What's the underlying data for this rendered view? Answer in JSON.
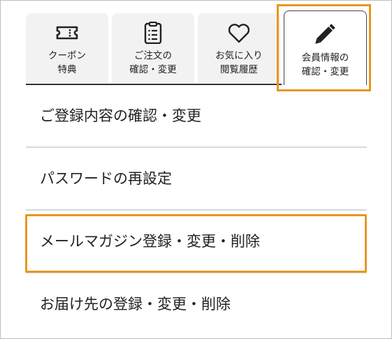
{
  "tabs": [
    {
      "icon": "ticket-icon",
      "line1": "クーポン",
      "line2": "特典"
    },
    {
      "icon": "clipboard-icon",
      "line1": "ご注文の",
      "line2": "確認・変更"
    },
    {
      "icon": "heart-icon",
      "line1": "お気に入り",
      "line2": "閲覧履歴"
    },
    {
      "icon": "pencil-icon",
      "line1": "会員情報の",
      "line2": "確認・変更",
      "active": true
    }
  ],
  "menu": {
    "items": [
      {
        "label": "ご登録内容の確認・変更"
      },
      {
        "label": "パスワードの再設定"
      },
      {
        "label": "メールマガジン登録・変更・削除"
      },
      {
        "label": "お届け先の登録・変更・削除"
      }
    ]
  },
  "colors": {
    "highlight": "#e8961f",
    "tab_bg": "#f2f2f2",
    "divider": "#d9d9d9"
  }
}
